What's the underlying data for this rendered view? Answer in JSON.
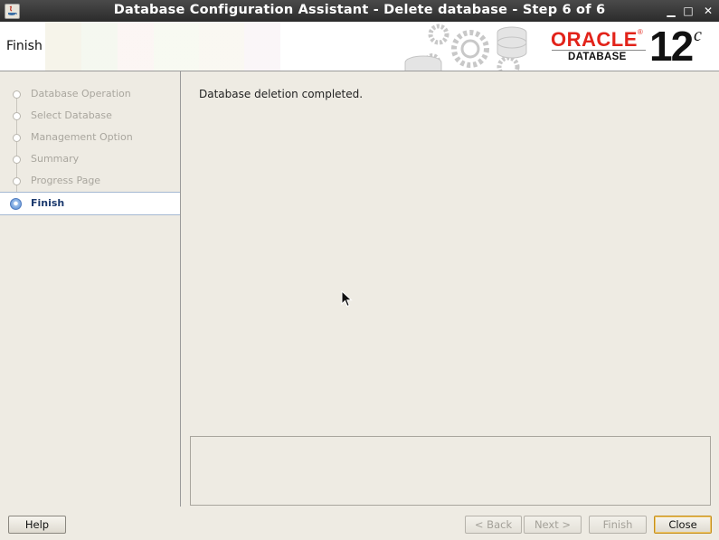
{
  "window": {
    "title": "Database Configuration Assistant - Delete database - Step 6 of 6",
    "controls": {
      "minimize": "▁",
      "maximize": "□",
      "close": "✕"
    }
  },
  "header": {
    "page_title": "Finish",
    "logo": {
      "brand": "ORACLE",
      "registered": "®",
      "product": "DATABASE",
      "version": "12",
      "version_suffix": "c"
    }
  },
  "sidebar": {
    "steps": [
      {
        "label": "Database Operation",
        "state": "done"
      },
      {
        "label": "Select Database",
        "state": "done"
      },
      {
        "label": "Management Option",
        "state": "done"
      },
      {
        "label": "Summary",
        "state": "done"
      },
      {
        "label": "Progress Page",
        "state": "done"
      },
      {
        "label": "Finish",
        "state": "active"
      }
    ]
  },
  "main": {
    "message": "Database deletion completed.",
    "details": ""
  },
  "footer": {
    "help": "Help",
    "back": "< Back",
    "next": "Next >",
    "finish": "Finish",
    "close": "Close"
  },
  "colors": {
    "accent_red": "#e2231a",
    "active_step": "#1c3a6e",
    "background": "#eeebe3"
  }
}
